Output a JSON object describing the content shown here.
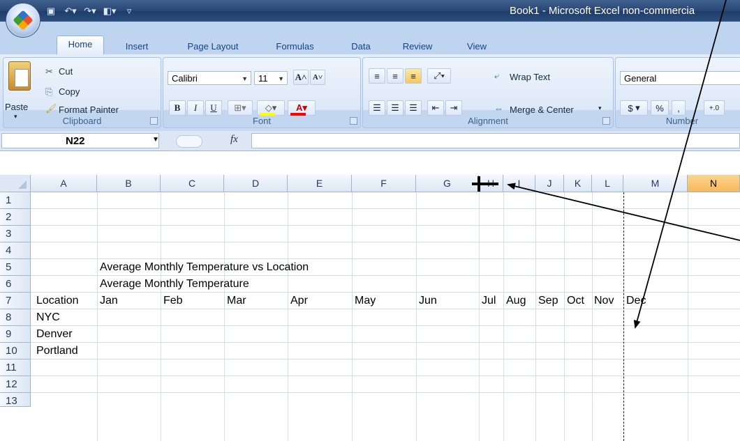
{
  "window": {
    "title": "Book1 - Microsoft Excel non-commercia"
  },
  "tabs": [
    "Home",
    "Insert",
    "Page Layout",
    "Formulas",
    "Data",
    "Review",
    "View"
  ],
  "clipboard": {
    "paste": "Paste",
    "cut": "Cut",
    "copy": "Copy",
    "format_painter": "Format Painter",
    "label": "Clipboard"
  },
  "font": {
    "name": "Calibri",
    "size": "11",
    "label": "Font",
    "bold": "B",
    "italic": "I",
    "underline": "U"
  },
  "alignment": {
    "wrap_text": "Wrap Text",
    "merge_center": "Merge & Center",
    "label": "Alignment"
  },
  "number": {
    "format": "General",
    "label": "Number",
    "currency": "$",
    "percent": "%"
  },
  "formula_bar": {
    "name_box": "N22",
    "fx": "fx",
    "value": ""
  },
  "columns": [
    "A",
    "B",
    "C",
    "D",
    "E",
    "F",
    "G",
    "H",
    "I",
    "J",
    "K",
    "L",
    "M",
    "N"
  ],
  "rows": [
    "1",
    "2",
    "3",
    "4",
    "5",
    "6",
    "7",
    "8",
    "9",
    "10",
    "11",
    "12",
    "13"
  ],
  "cells": {
    "B4": "Average Monthly Temperature vs Location",
    "B5": "Average Monthly Temperature",
    "A6": "Location",
    "B6": "Jan",
    "C6": "Feb",
    "D6": "Mar",
    "E6": "Apr",
    "F6": "May",
    "G6": "Jun",
    "H6": "Jul",
    "I6": "Aug",
    "J6": "Sep",
    "K6": "Oct",
    "L6": "Nov",
    "M6": "Dec",
    "A7": "NYC",
    "A8": "Denver",
    "A9": "Portland"
  },
  "colors": {
    "title_bar": "#2b4a78",
    "ribbon": "#d5e3f5",
    "selected_column": "#f8b95a",
    "grid_line": "#d6dde7"
  }
}
